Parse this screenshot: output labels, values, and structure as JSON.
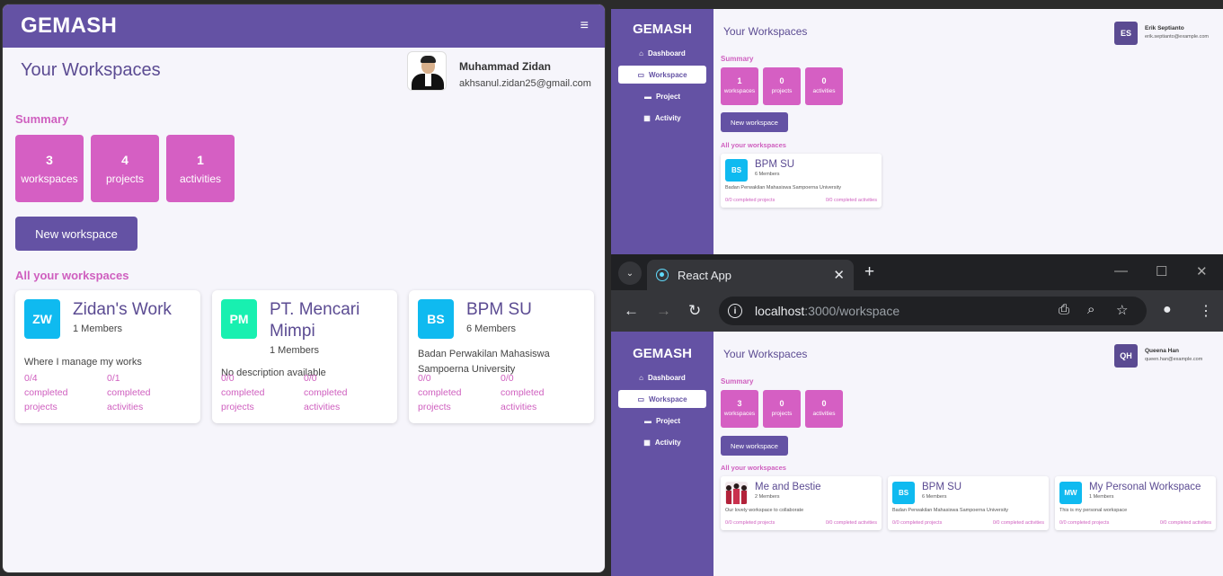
{
  "colors": {
    "brand": "#6452a4",
    "pink": "#d55fc3",
    "title": "#5b4b92",
    "bg": "#f6f5fb"
  },
  "left": {
    "brand": "GEMASH",
    "menu_icon": "≡",
    "title": "Your Workspaces",
    "user": {
      "name": "Muhammad Zidan",
      "email": "akhsanul.zidan25@gmail.com"
    },
    "summary_label": "Summary",
    "stats": [
      {
        "value": "3",
        "label": "workspaces"
      },
      {
        "value": "4",
        "label": "projects"
      },
      {
        "value": "1",
        "label": "activities"
      }
    ],
    "new_button": "New workspace",
    "all_label": "All your workspaces",
    "cards": [
      {
        "initials": "ZW",
        "color": "#0fbaf0",
        "name": "Zidan's Work",
        "members": "1 Members",
        "description": "Where I manage my works",
        "projects": "0/4 completed projects",
        "activities": "0/1 completed activities"
      },
      {
        "initials": "PM",
        "color": "#18f0b0",
        "name": "PT. Mencari Mimpi",
        "members": "1 Members",
        "description": "No description available",
        "projects": "0/0 completed projects",
        "activities": "0/0 completed activities"
      },
      {
        "initials": "BS",
        "color": "#0fbaf0",
        "name": "BPM SU",
        "members": "6 Members",
        "description": "Badan Perwakilan Mahasiswa Sampoerna University",
        "projects": "0/0 completed projects",
        "activities": "0/0 completed activities"
      }
    ]
  },
  "topright": {
    "brand": "GEMASH",
    "nav": [
      {
        "icon": "home-icon",
        "glyph": "⌂",
        "label": "Dashboard"
      },
      {
        "icon": "briefcase-icon",
        "glyph": "▭",
        "label": "Workspace"
      },
      {
        "icon": "project-icon",
        "glyph": "▬",
        "label": "Project"
      },
      {
        "icon": "calendar-icon",
        "glyph": "▦",
        "label": "Activity"
      }
    ],
    "title": "Your Workspaces",
    "user": {
      "initials": "ES",
      "name": "Erik Septianto",
      "email": "erik.septianto@example.com"
    },
    "summary_label": "Summary",
    "stats": [
      {
        "value": "1",
        "label": "workspaces"
      },
      {
        "value": "0",
        "label": "projects"
      },
      {
        "value": "0",
        "label": "activities"
      }
    ],
    "new_button": "New workspace",
    "all_label": "All your workspaces",
    "cards": [
      {
        "initials": "BS",
        "color": "#0fbaf0",
        "name": "BPM SU",
        "members": "6 Members",
        "description": "Badan Perwakilan Mahasiswa Sampoerna University",
        "projects": "0/0 completed projects",
        "activities": "0/0 completed activities"
      }
    ]
  },
  "browser": {
    "tab_title": "React App",
    "url_host": "localhost",
    "url_path": ":3000/workspace",
    "app": {
      "brand": "GEMASH",
      "nav": [
        {
          "icon": "home-icon",
          "glyph": "⌂",
          "label": "Dashboard"
        },
        {
          "icon": "briefcase-icon",
          "glyph": "▭",
          "label": "Workspace"
        },
        {
          "icon": "project-icon",
          "glyph": "▬",
          "label": "Project"
        },
        {
          "icon": "calendar-icon",
          "glyph": "▦",
          "label": "Activity"
        }
      ],
      "title": "Your Workspaces",
      "user": {
        "initials": "QH",
        "name": "Queena Han",
        "email": "queen.han@example.com"
      },
      "summary_label": "Summary",
      "stats": [
        {
          "value": "3",
          "label": "workspaces"
        },
        {
          "value": "0",
          "label": "projects"
        },
        {
          "value": "0",
          "label": "activities"
        }
      ],
      "new_button": "New workspace",
      "all_label": "All your workspaces",
      "cards": [
        {
          "initials": "",
          "color": "#ffffff",
          "image": true,
          "name": "Me and Bestie",
          "members": "2 Members",
          "description": "Our lovely workspace to collaborate",
          "projects": "0/0 completed projects",
          "activities": "0/0 completed activities"
        },
        {
          "initials": "BS",
          "color": "#0fbaf0",
          "name": "BPM SU",
          "members": "6 Members",
          "description": "Badan Perwakilan Mahasiswa Sampoerna University",
          "projects": "0/0 completed projects",
          "activities": "0/0 completed activities"
        },
        {
          "initials": "MW",
          "color": "#0fbaf0",
          "name": "My Personal Workspace",
          "members": "1 Members",
          "description": "This is my personal workspace",
          "projects": "0/0 completed projects",
          "activities": "0/0 completed activities"
        }
      ]
    }
  }
}
